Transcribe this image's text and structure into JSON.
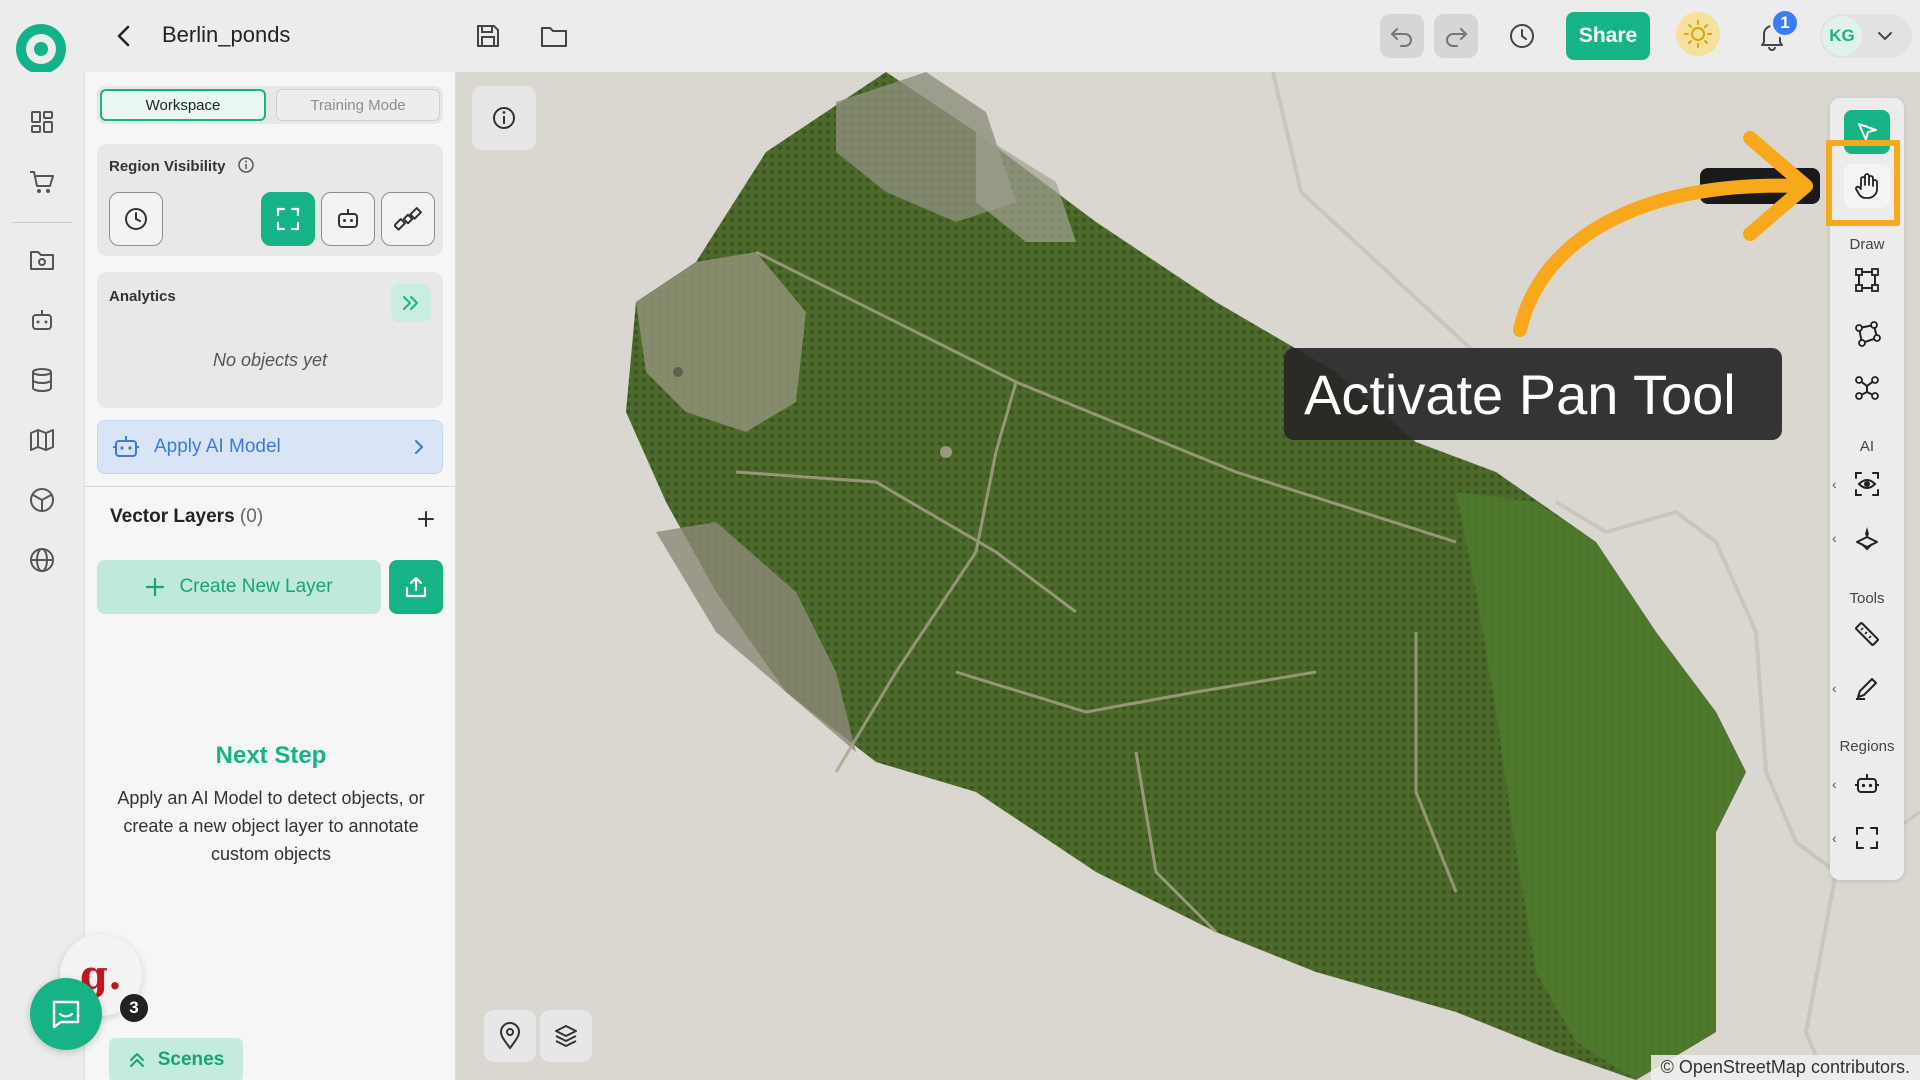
{
  "header": {
    "project_name": "Berlin_ponds",
    "share_label": "Share",
    "notification_count": "1",
    "user_initials": "KG"
  },
  "panel": {
    "tabs": [
      {
        "label": "Workspace",
        "active": true
      },
      {
        "label": "Training Mode",
        "active": false
      }
    ],
    "region_visibility_label": "Region Visibility",
    "analytics_label": "Analytics",
    "analytics_empty": "No objects yet",
    "apply_ai_label": "Apply AI Model",
    "vector_layers_label": "Vector Layers",
    "vector_layers_count": "(0)",
    "create_layer_label": "Create New Layer",
    "next_step_title": "Next Step",
    "next_step_desc": "Apply an AI Model to detect objects, or create a new object layer to annotate custom objects",
    "scenes_label": "Scenes"
  },
  "widgets": {
    "g_letter": "g.",
    "chat_badge": "3"
  },
  "toolbar": {
    "draw_label": "Draw",
    "ai_label": "AI",
    "tools_label": "Tools",
    "regions_label": "Regions"
  },
  "map": {
    "attribution": "© OpenStreetMap contributors."
  },
  "callout": {
    "text": "Activate Pan Tool"
  },
  "colors": {
    "accent": "#16b387",
    "highlight": "#f7a81b",
    "ai_blue": "#3e7bd8"
  }
}
